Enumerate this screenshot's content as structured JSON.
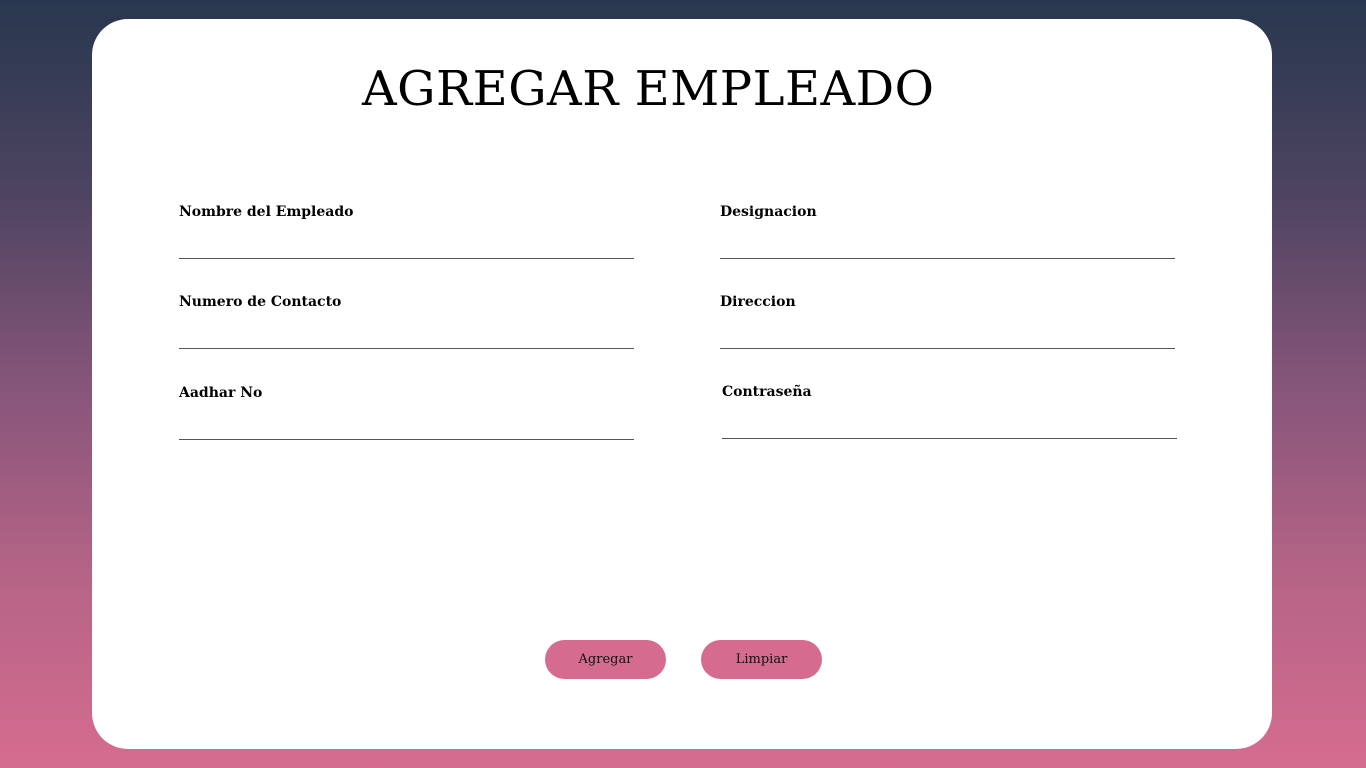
{
  "form": {
    "title": "AGREGAR EMPLEADO",
    "fields": [
      {
        "label": "Nombre del Empleado",
        "value": "",
        "placeholder": ""
      },
      {
        "label": "Designacion",
        "value": "",
        "placeholder": ""
      },
      {
        "label": "Numero de Contacto",
        "value": "",
        "placeholder": ""
      },
      {
        "label": "Direccion",
        "value": "",
        "placeholder": ""
      },
      {
        "label": "Aadhar No",
        "value": "",
        "placeholder": ""
      },
      {
        "label": "Contraseña",
        "value": "",
        "placeholder": ""
      }
    ],
    "buttons": {
      "add_label": "Agregar",
      "clear_label": "Limpiar"
    }
  },
  "colors": {
    "button": "#d56c8f",
    "card": "#ffffff",
    "gradient_top": "#28374f",
    "gradient_bottom": "#d56c8f"
  }
}
